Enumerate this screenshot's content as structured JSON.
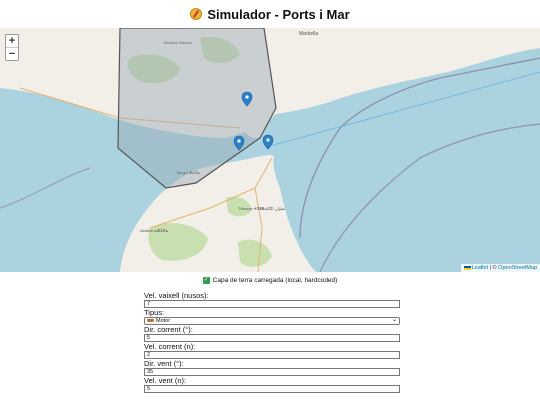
{
  "app": {
    "title": "Simulador - Ports i Mar"
  },
  "map": {
    "zoom_in": "+",
    "zoom_out": "−",
    "labels": {
      "city_top_right": "Marbella",
      "city_west": "Medina Sidonia",
      "tetouan": "Tétouan ⵜⵉⵟⵟⴰⵡⵉⵏ تطوان",
      "assilah": "Assilah ⴰⵚⵉⵍⴰ",
      "tangier": "Tanger ⵟⴰⵏⵊⴰ"
    },
    "attribution": {
      "leaflet": "Leaflet",
      "separator": " | © ",
      "osm": "OpenStreetMap"
    },
    "colors": {
      "sea": "#aad3df",
      "land": "#f2efe9",
      "forest": "#c8dfb0",
      "polygon_stroke": "#555555",
      "marker": "#2a81cb"
    }
  },
  "status": {
    "text": "Capa de terra carregada (local, hardcoded)"
  },
  "form": {
    "vessel_speed": {
      "label": "Vel. vaixell (nusos):",
      "value": "7"
    },
    "type": {
      "label": "Tipus:",
      "value": "Motor"
    },
    "current_dir": {
      "label": "Dir. corrent (°):",
      "value": "5"
    },
    "current_speed": {
      "label": "Vel. corrent (n):",
      "value": "2"
    },
    "wind_dir": {
      "label": "Dir. vent (°):",
      "value": "35"
    },
    "wind_speed": {
      "label": "Vel. vent (n):",
      "value": "5"
    }
  }
}
